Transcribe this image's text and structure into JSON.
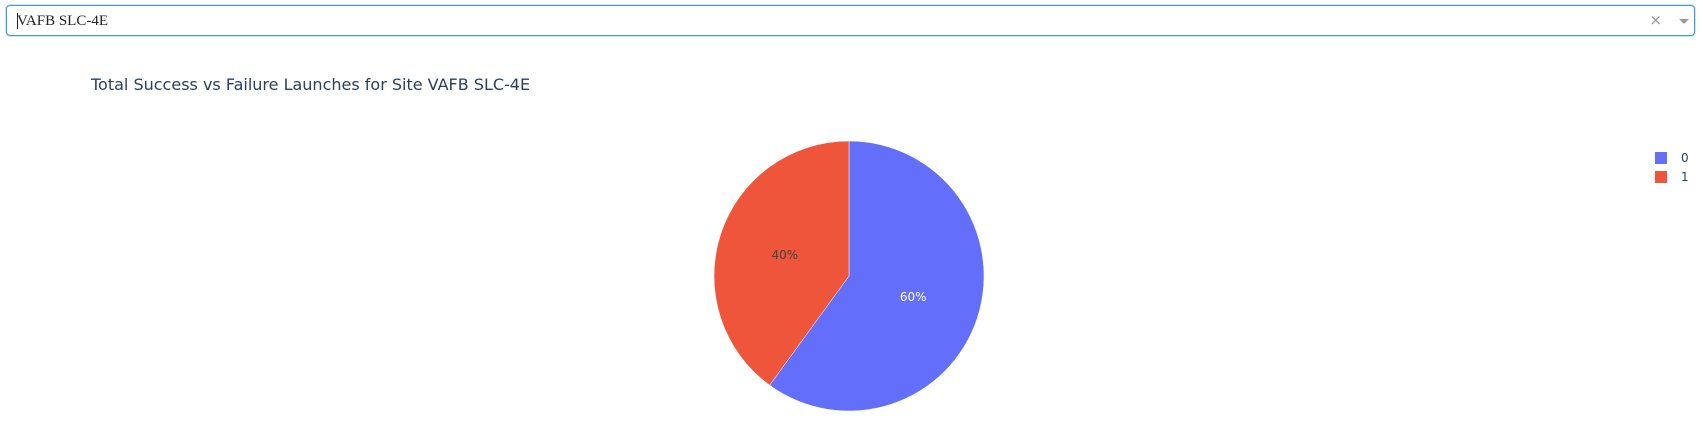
{
  "dropdown": {
    "selected_value": "VAFB SLC-4E",
    "clear_symbol": "×"
  },
  "chart_data": {
    "type": "pie",
    "title": "Total Success vs Failure Launches for Site VAFB SLC-4E",
    "slices": [
      {
        "label": "0",
        "percent": 60,
        "text": "60%",
        "color": "#636efa"
      },
      {
        "label": "1",
        "percent": 40,
        "text": "40%",
        "color": "#ef553b"
      }
    ],
    "legend": [
      "0",
      "1"
    ],
    "legend_placement": "top-right"
  }
}
